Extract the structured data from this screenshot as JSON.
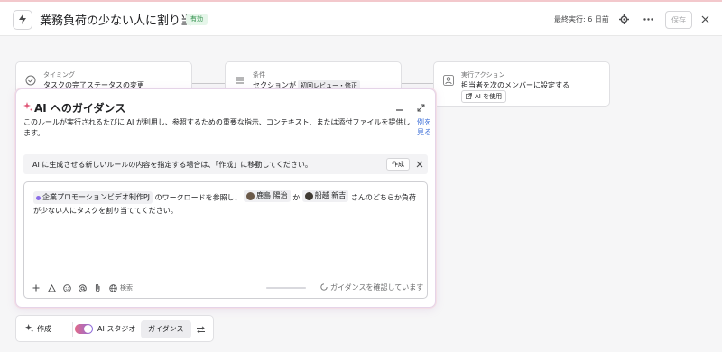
{
  "header": {
    "title": "業務負荷の少ない人に割り当て",
    "status": "有効",
    "last_run": "最終実行: 6 日前",
    "save_label": "保存",
    "icons": [
      "bolt-icon",
      "gear-icon",
      "more-icon",
      "close-icon"
    ]
  },
  "flow": {
    "trigger": {
      "title": "タイミング",
      "text": "タスクの完了ステータスの変更",
      "icon": "check-circle-icon"
    },
    "condition": {
      "title": "条件",
      "text": "セクションが",
      "chip": "初回レビュー・修正",
      "icon": "list-icon"
    },
    "action": {
      "title": "実行アクション",
      "text": "担当者を次のメンバーに設定する",
      "chip": "AI を使用",
      "icon": "user-icon"
    }
  },
  "guidance_panel": {
    "title": "AI へのガイダンス",
    "description": "このルールが実行されるたびに AI が利用し、参照するための重要な指示、コンテキスト、または添付ファイルを提供します。",
    "see_example": "例を見る",
    "banner": {
      "text": "AI に生成させる新しいルールの内容を指定する場合は、「作成」に移動してください。",
      "button": "作成"
    },
    "editor": {
      "project": "企業プロモーションビデオ制作PJ",
      "text1": "のワークロードを参照し、",
      "person1": "鹿島 陽治",
      "text2": "か",
      "person2": "船越 新吉",
      "text3": "さんのどちらか負荷が少ない人にタスクを割り当ててください。"
    },
    "toolbar": {
      "search_label": "検索",
      "checking": "ガイダンスを確認しています"
    }
  },
  "bottom_bar": {
    "create": "作成",
    "studio": "AI スタジオ",
    "guidance": "ガイダンス",
    "toggle_on": true
  }
}
